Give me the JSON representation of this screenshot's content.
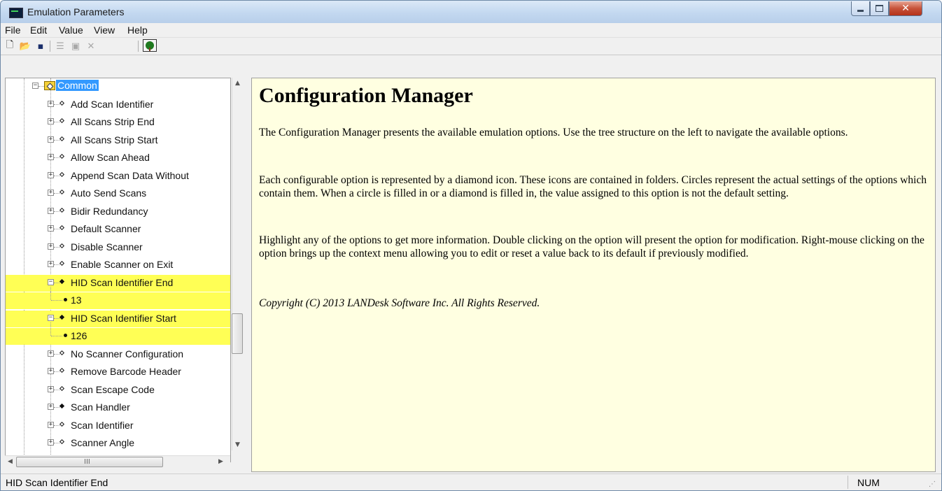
{
  "window": {
    "title": "Emulation Parameters"
  },
  "menu": [
    "File",
    "Edit",
    "Value",
    "View",
    "Help"
  ],
  "toolbar": {
    "icons": [
      "new-file-icon",
      "open-folder-icon",
      "save-icon",
      "list-icon",
      "properties-icon",
      "delete-icon",
      "tree-view-icon"
    ]
  },
  "tree": {
    "root": {
      "label": "Common",
      "expanded": true,
      "selected": true
    },
    "items": [
      {
        "label": "Add Scan Identifier",
        "filled": false
      },
      {
        "label": "All Scans Strip End",
        "filled": false
      },
      {
        "label": "All Scans Strip Start",
        "filled": false
      },
      {
        "label": "Allow Scan Ahead",
        "filled": false
      },
      {
        "label": "Append Scan Data Without",
        "filled": false
      },
      {
        "label": "Auto Send Scans",
        "filled": false
      },
      {
        "label": "Bidir Redundancy",
        "filled": false
      },
      {
        "label": "Default Scanner",
        "filled": false
      },
      {
        "label": "Disable Scanner",
        "filled": false
      },
      {
        "label": "Enable Scanner on Exit",
        "filled": false
      },
      {
        "label": "HID Scan Identifier End",
        "filled": true,
        "expanded": true,
        "highlight": true,
        "value": "13"
      },
      {
        "label": "HID Scan Identifier Start",
        "filled": true,
        "expanded": true,
        "highlight": true,
        "value": "126"
      },
      {
        "label": "No Scanner Configuration",
        "filled": false
      },
      {
        "label": "Remove Barcode Header",
        "filled": false
      },
      {
        "label": "Scan Escape Code",
        "filled": false
      },
      {
        "label": "Scan Handler",
        "filled": true
      },
      {
        "label": "Scan Identifier",
        "filled": false
      },
      {
        "label": "Scanner Angle",
        "filled": false
      }
    ]
  },
  "content": {
    "heading": "Configuration Manager",
    "p1": "The Configuration Manager presents the available emulation options.  Use the tree structure on the left to navigate the available options.",
    "p2": "Each configurable option is represented by a diamond icon.  These icons are contained in folders.  Circles represent the actual settings of the options which contain them.  When a circle is filled in or a diamond is filled in, the value assigned to this option is not the default setting.",
    "p3": "Highlight any of the options to get more information.  Double clicking on the option will present the option for modification. Right-mouse clicking on the option brings up the context menu allowing you to edit or reset a value back to its default if previously modified.",
    "copyright": "Copyright (C) 2013 LANDesk Software Inc.  All Rights Reserved."
  },
  "statusbar": {
    "text": "HID Scan Identifier End",
    "num": "NUM"
  },
  "scroll": {
    "vertical_arrow_up": "▲",
    "vertical_arrow_down": "▼",
    "horizontal_arrow_left": "◀",
    "horizontal_arrow_right": "▶",
    "grip": "III"
  }
}
